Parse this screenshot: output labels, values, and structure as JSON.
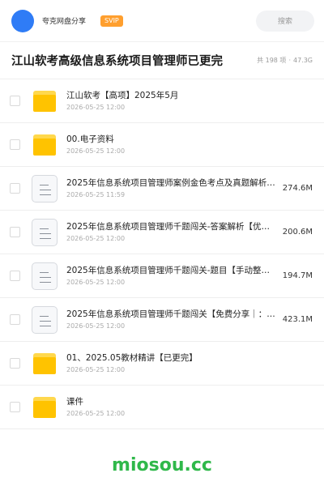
{
  "header": {
    "share_name": "夸克网盘分享",
    "badge": "SVIP",
    "search_label": "搜索",
    "accent": "#2f7cf6",
    "badge_color": "#ff9f2e"
  },
  "title": {
    "text": "江山软考高级信息系统项目管理师已更完",
    "count": "共 198 项",
    "dot": "·",
    "total_size": "47.3G"
  },
  "files": [
    {
      "type": "folder",
      "name": "江山软考【高项】2025年5月",
      "date": "2026-05-25 12:00",
      "size": ""
    },
    {
      "type": "folder",
      "name": "00.电子资料",
      "date": "2026-05-25 12:00",
      "size": ""
    },
    {
      "type": "doc",
      "name": "2025年信息系统项目管理师案例金色考点及真题解析…",
      "date": "2026-05-25 11:59",
      "size": "274.6M"
    },
    {
      "type": "doc",
      "name": "2025年信息系统项目管理师千题闯关-答案解析【优…",
      "date": "2026-05-25 12:00",
      "size": "200.6M"
    },
    {
      "type": "doc",
      "name": "2025年信息系统项目管理师千题闯关-题目【手动整…",
      "date": "2026-05-25 12:00",
      "size": "194.7M"
    },
    {
      "type": "doc",
      "name": "2025年信息系统项目管理师千题闯关【免费分享｜：…",
      "date": "2026-05-25 12:00",
      "size": "423.1M"
    },
    {
      "type": "folder",
      "name": "01、2025.05教材精讲【已更完】",
      "date": "2026-05-25 12:00",
      "size": ""
    },
    {
      "type": "folder",
      "name": "课件",
      "date": "2026-05-25 12:00",
      "size": ""
    }
  ],
  "watermark": "miosou.cc"
}
